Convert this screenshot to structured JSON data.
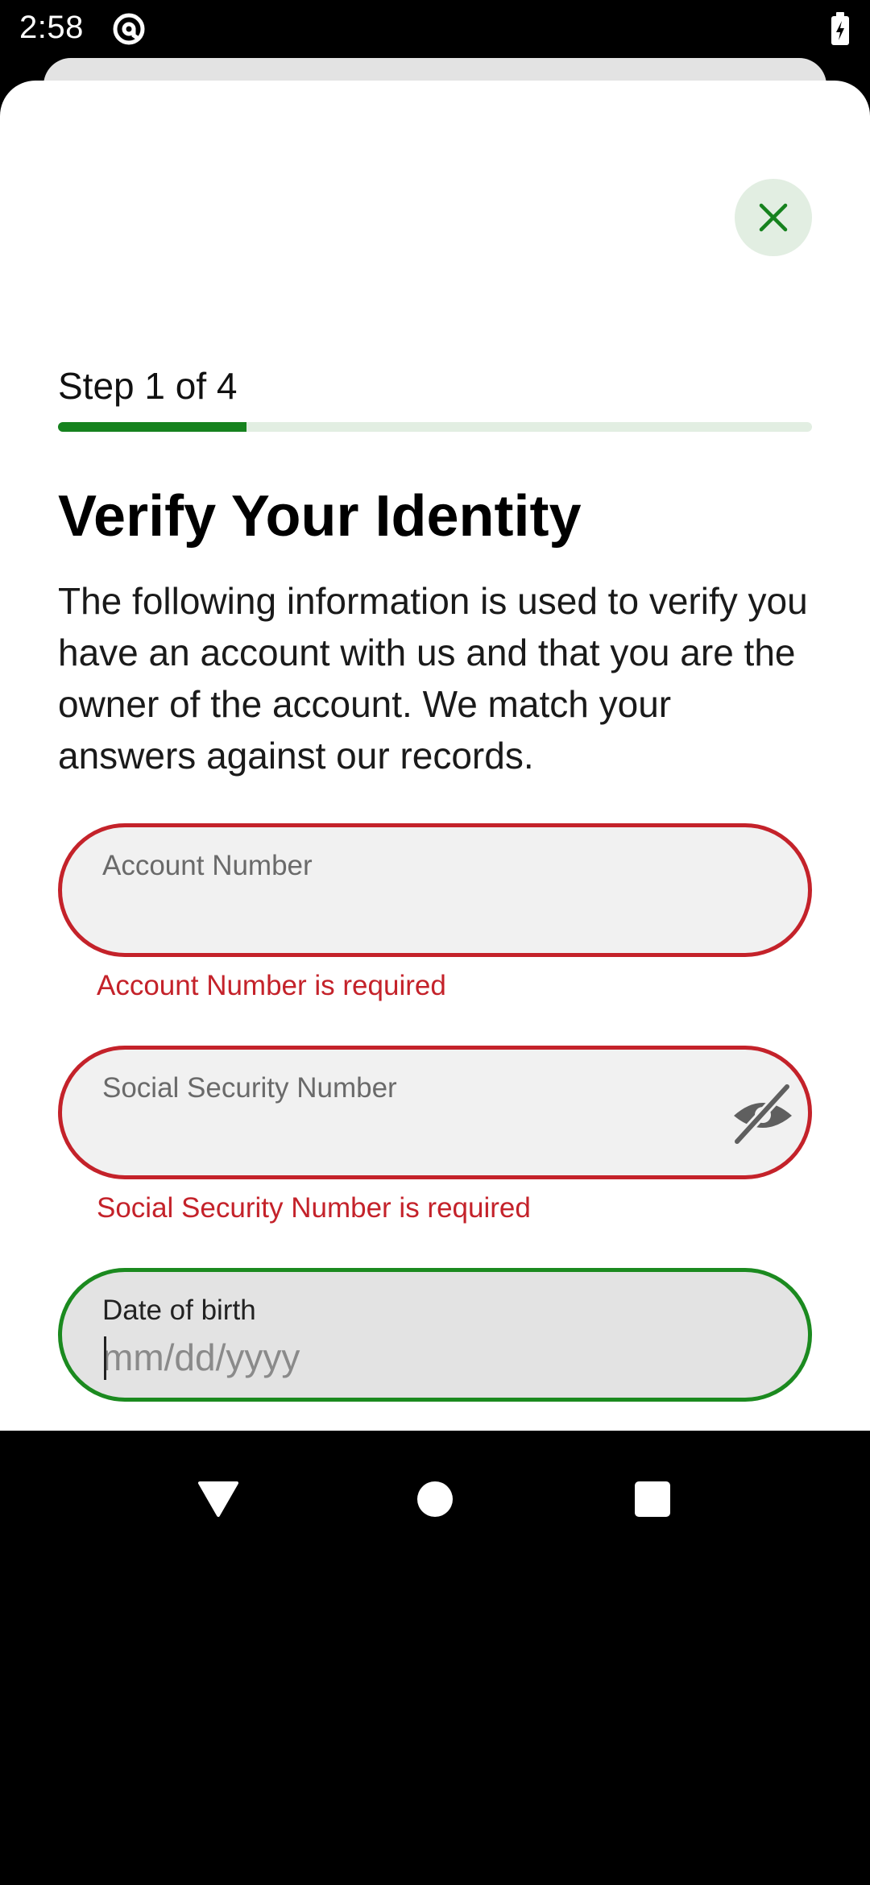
{
  "status_bar": {
    "time": "2:58",
    "left_icon": "at-sign-circle-icon",
    "right_icon": "battery-charging-icon"
  },
  "colors": {
    "accent_green": "#16821e",
    "error_red": "#c4222a",
    "progress_track": "#e2eee2"
  },
  "header": {
    "close_icon": "close-icon"
  },
  "progress": {
    "step_text": "Step 1 of 4",
    "fraction": 0.25
  },
  "content": {
    "title": "Verify Your Identity",
    "description": "The following information is used to verify you have an account with us and that you are the owner of the account. We match your answers against our records."
  },
  "form": {
    "account_number": {
      "label": "Account Number",
      "value": "",
      "error": "Account Number is required"
    },
    "ssn": {
      "label": "Social Security Number",
      "value": "",
      "error": "Social Security Number is required",
      "toggle_icon": "eye-off-icon"
    },
    "dob": {
      "label": "Date of birth",
      "value": "",
      "placeholder": "mm/dd/yyyy"
    }
  },
  "nav_bar": {
    "back_icon": "back-triangle-icon",
    "home_icon": "home-circle-icon",
    "recents_icon": "recents-square-icon"
  }
}
